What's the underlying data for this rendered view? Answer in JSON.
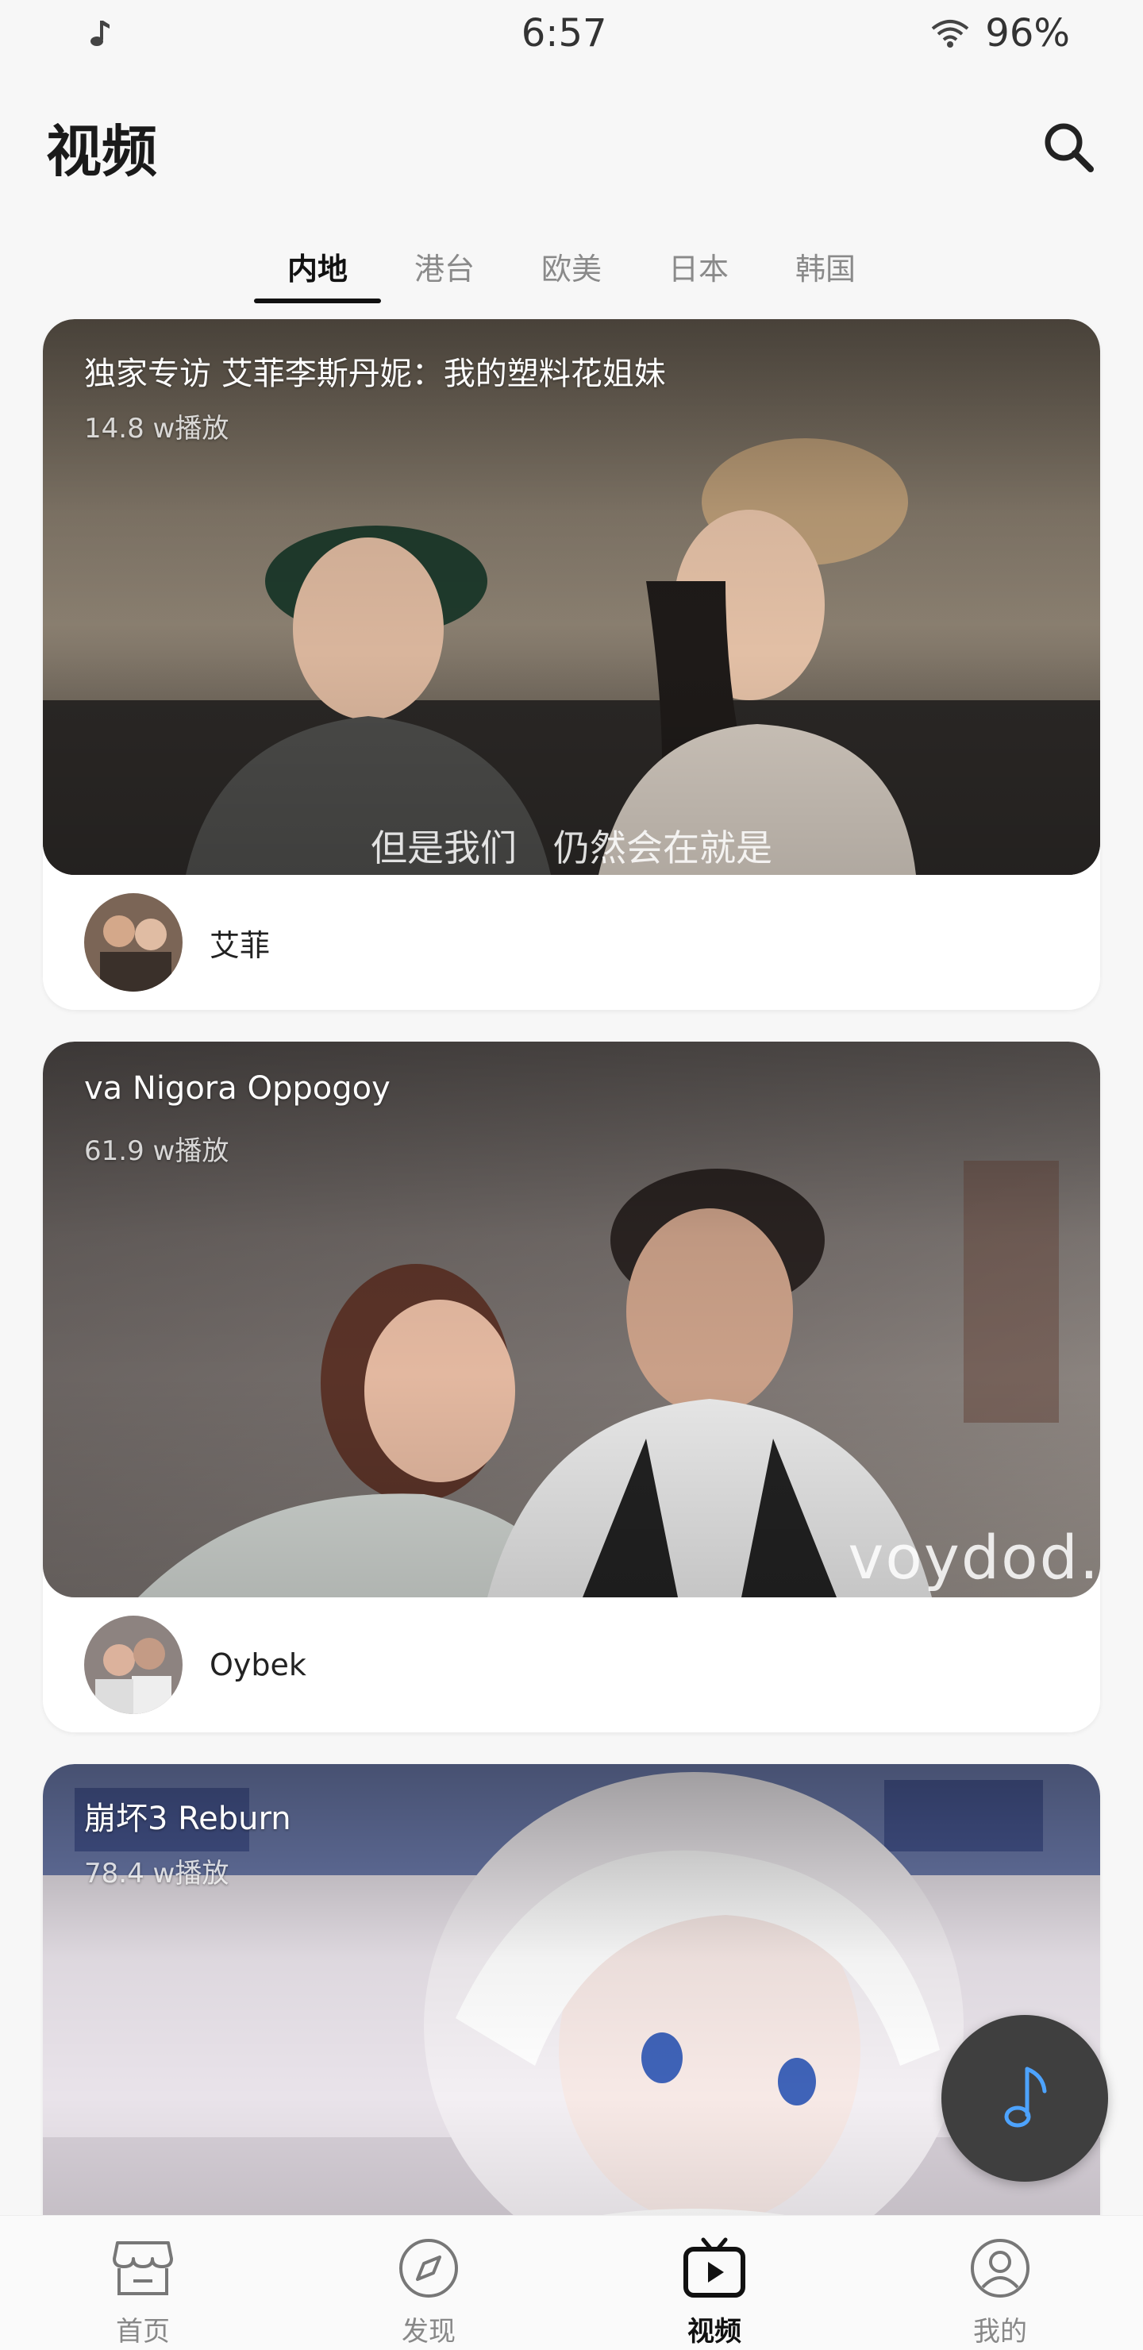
{
  "status_bar": {
    "time": "6:57",
    "battery": "96%",
    "music_icon": "music-note-icon",
    "wifi_icon": "wifi-icon"
  },
  "header": {
    "title": "视频",
    "search_icon": "search-icon"
  },
  "tabs": [
    {
      "label": "内地",
      "active": true
    },
    {
      "label": "港台",
      "active": false
    },
    {
      "label": "欧美",
      "active": false
    },
    {
      "label": "日本",
      "active": false
    },
    {
      "label": "韩国",
      "active": false
    }
  ],
  "videos": [
    {
      "title": "独家专访 艾菲李斯丹妮：我的塑料花姐妹",
      "views": "14.8 w播放",
      "subtitle": "但是我们　仍然会在就是",
      "author": "艾菲"
    },
    {
      "title": "va Nigora Oppogoy",
      "views": "61.9 w播放",
      "watermark": "voydod.",
      "author": "Oybek"
    },
    {
      "title": "崩坏3 Reburn",
      "views": "78.4 w播放"
    }
  ],
  "fab": {
    "icon": "music-note-icon"
  },
  "bottom_nav": [
    {
      "label": "首页",
      "icon": "shop-icon",
      "active": false
    },
    {
      "label": "发现",
      "icon": "compass-icon",
      "active": false
    },
    {
      "label": "视频",
      "icon": "tv-play-icon",
      "active": true
    },
    {
      "label": "我的",
      "icon": "person-icon",
      "active": false
    }
  ],
  "colors": {
    "background": "#f7f7f7",
    "accent_text": "#111111",
    "muted_text": "#8a8a8a",
    "fab_bg": "#3f3f3f",
    "fab_icon": "#4da3ff"
  }
}
